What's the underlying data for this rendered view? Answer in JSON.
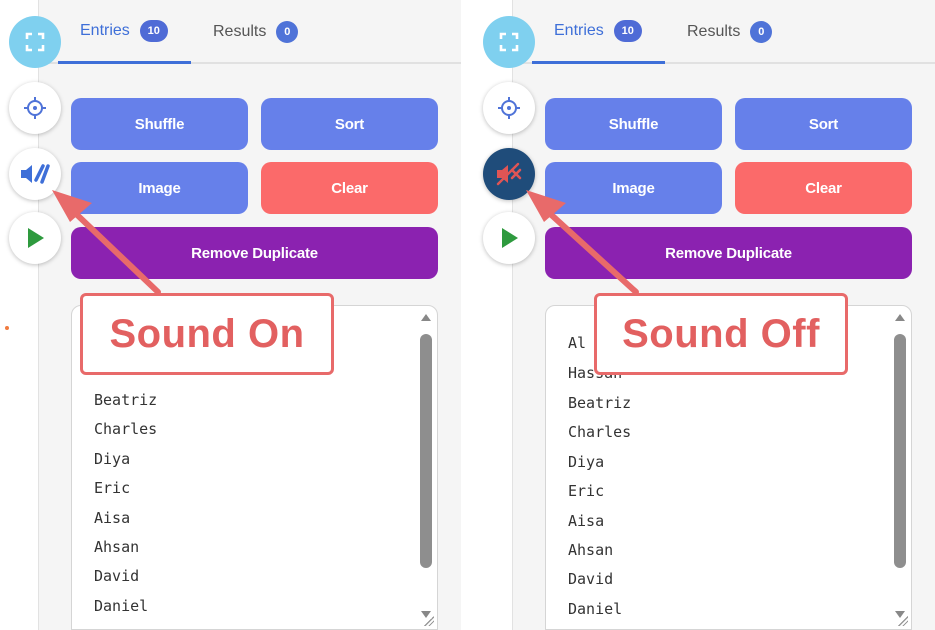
{
  "panels": [
    {
      "tabs": [
        {
          "label": "Entries",
          "count": "10"
        },
        {
          "label": "Results",
          "count": "0"
        }
      ],
      "buttons": {
        "shuffle": "Shuffle",
        "sort": "Sort",
        "image": "Image",
        "clear": "Clear",
        "remove_duplicate": "Remove Duplicate"
      },
      "entries": [
        "Beatriz",
        "Charles",
        "Diya",
        "Eric",
        "Aisa",
        "Ahsan",
        "David",
        "Daniel"
      ],
      "sound_state": "on",
      "callout": "Sound On"
    },
    {
      "tabs": [
        {
          "label": "Entries",
          "count": "10"
        },
        {
          "label": "Results",
          "count": "0"
        }
      ],
      "buttons": {
        "shuffle": "Shuffle",
        "sort": "Sort",
        "image": "Image",
        "clear": "Clear",
        "remove_duplicate": "Remove Duplicate"
      },
      "entries": [
        "Al",
        "Hassan",
        "Beatriz",
        "Charles",
        "Diya",
        "Eric",
        "Aisa",
        "Ahsan",
        "David",
        "Daniel"
      ],
      "sound_state": "off",
      "callout": "Sound Off"
    }
  ],
  "icons": {
    "fullscreen": "fullscreen-icon",
    "target": "crosshair-icon",
    "sound_on": "speaker-on-icon",
    "sound_off": "speaker-muted-icon",
    "play": "play-icon"
  },
  "colors": {
    "accent": "#3e6fd8",
    "button_blue": "#6680ea",
    "button_red": "#fb6a6a",
    "button_purple": "#8b22b0",
    "callout_red": "#e86a6a",
    "play_green": "#2e9a3e"
  }
}
